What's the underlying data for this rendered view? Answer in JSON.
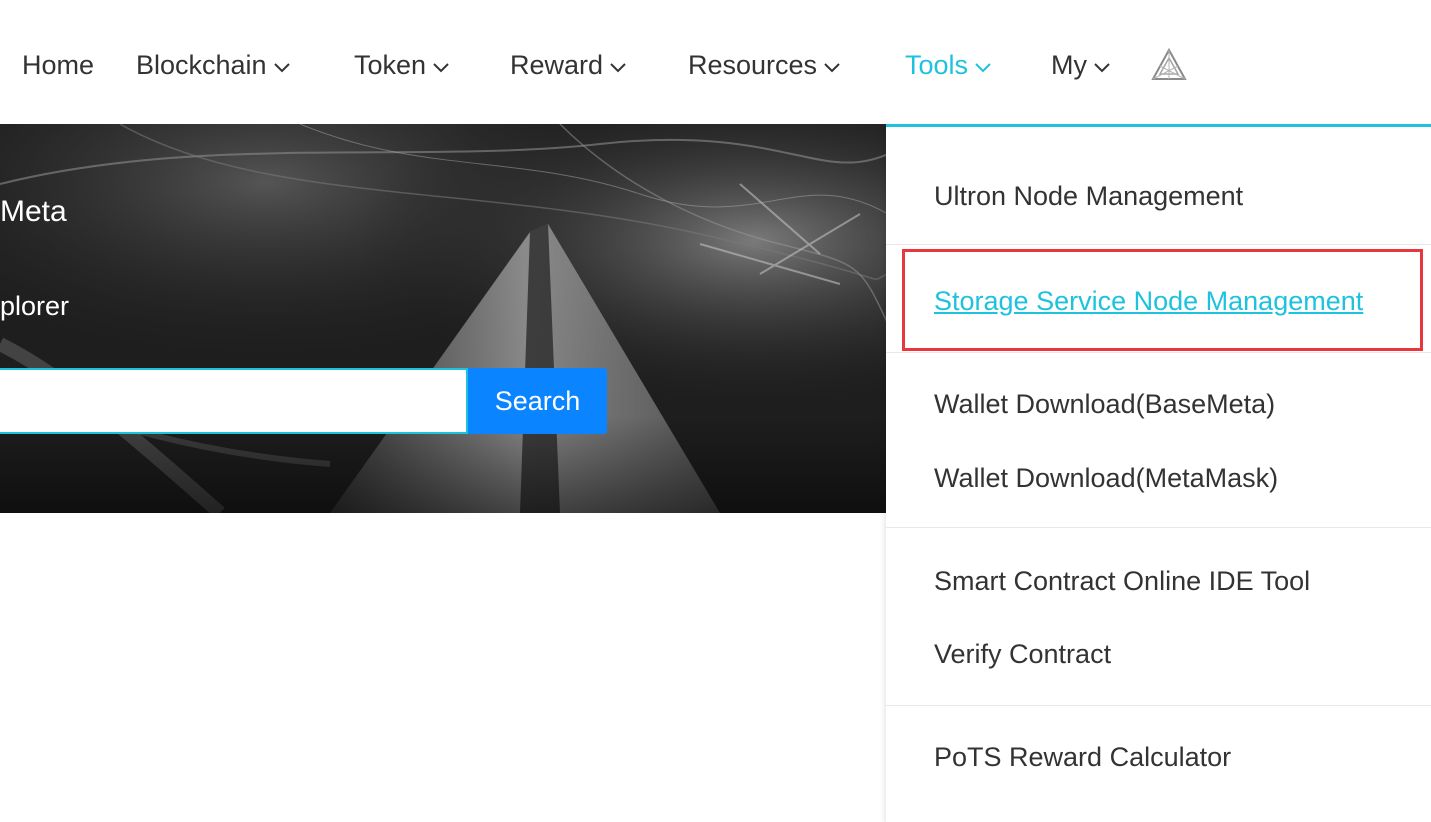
{
  "nav": {
    "items": [
      {
        "label": "Home"
      },
      {
        "label": "Blockchain"
      },
      {
        "label": "Token"
      },
      {
        "label": "Reward"
      },
      {
        "label": "Resources"
      },
      {
        "label": "Tools"
      },
      {
        "label": "My"
      }
    ],
    "active": "Tools",
    "logo_icon": "triangle-logo-icon"
  },
  "hero": {
    "title_partial": "Meta",
    "subtitle_partial": "plorer",
    "search": {
      "value": "",
      "placeholder": "",
      "button_label": "Search"
    }
  },
  "dropdown": {
    "groups": [
      [
        {
          "label": "Ultron Node Management"
        }
      ],
      [
        {
          "label": "Storage Service Node Management",
          "highlighted": true
        }
      ],
      [
        {
          "label": "Wallet Download(BaseMeta)"
        },
        {
          "label": "Wallet Download(MetaMask)"
        }
      ],
      [
        {
          "label": "Smart Contract Online IDE Tool"
        },
        {
          "label": "Verify Contract"
        }
      ],
      [
        {
          "label": "PoTS Reward Calculator"
        }
      ]
    ]
  },
  "colors": {
    "accent": "#1fc2de",
    "search_button": "#0a84ff",
    "highlight_border": "#e8383d",
    "text": "#333333"
  }
}
